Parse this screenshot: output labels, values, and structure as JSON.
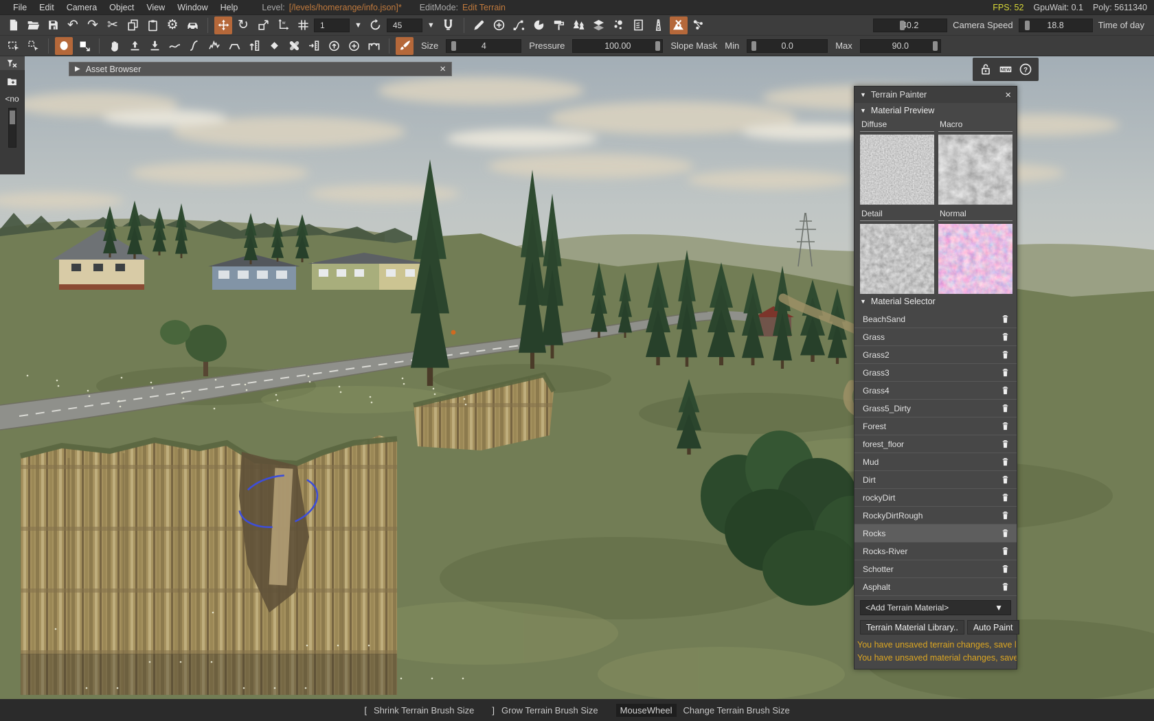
{
  "colors": {
    "accent": "#b5683a",
    "warn": "#dca622",
    "fps": "#d8d838",
    "level": "#c07a3d",
    "selection": "#5e5e5e"
  },
  "menu_bar": {
    "items": [
      "File",
      "Edit",
      "Camera",
      "Object",
      "View",
      "Window",
      "Help"
    ],
    "level_label": "Level:",
    "level_value": "[/levels/homerange/info.json]*",
    "editmode_label": "EditMode:",
    "editmode_value": "Edit Terrain",
    "fps_label": "FPS:",
    "fps_value": "52",
    "gpuwait_label": "GpuWait:",
    "gpuwait_value": "0.1",
    "poly_label": "Poly:",
    "poly_value": "5611340"
  },
  "toolbar_main": {
    "groups": {
      "file": [
        {
          "name": "new-file"
        },
        {
          "name": "open-folder"
        },
        {
          "name": "save-file"
        },
        {
          "name": "undo"
        },
        {
          "name": "redo"
        },
        {
          "name": "cut"
        },
        {
          "name": "copy"
        },
        {
          "name": "paste"
        },
        {
          "name": "settings"
        },
        {
          "name": "vehicle"
        }
      ],
      "transform": [
        {
          "name": "translate-tool",
          "active": true
        },
        {
          "name": "rotate-tool"
        },
        {
          "name": "scale-tool"
        },
        {
          "name": "world-axis"
        },
        {
          "name": "snap-grid"
        }
      ],
      "rotsnap": [
        {
          "name": "rotate-snap"
        }
      ],
      "magnet": [
        {
          "name": "terrain-magnet"
        }
      ],
      "tools": [
        {
          "name": "draw-pencil"
        },
        {
          "name": "add-object"
        },
        {
          "name": "spline-tool"
        },
        {
          "name": "sphere-tool"
        },
        {
          "name": "paint-roller"
        },
        {
          "name": "forest-tool"
        },
        {
          "name": "mesh-road-tool"
        },
        {
          "name": "particle-tool"
        },
        {
          "name": "river-tool"
        },
        {
          "name": "road-tool"
        },
        {
          "name": "terrain-painter-tool",
          "active": true
        },
        {
          "name": "mesh-nodes-tool"
        }
      ]
    },
    "snap_size_value": "1",
    "rotate_snap_value": "45",
    "camera_speed": {
      "value": "40.2",
      "label": "Camera Speed"
    },
    "time_of_day": {
      "value": "18.8",
      "label": "Time of day"
    }
  },
  "toolbar_terrain": {
    "groups": {
      "select": [
        {
          "name": "select-tool"
        },
        {
          "name": "select-move-tool"
        }
      ],
      "brush": [
        {
          "name": "brush-ellipse",
          "active": true
        },
        {
          "name": "brush-square"
        }
      ],
      "terrain": [
        {
          "name": "grab-terrain-tool"
        },
        {
          "name": "raise-height-tool"
        },
        {
          "name": "lower-height-tool"
        },
        {
          "name": "smooth-tool"
        },
        {
          "name": "slope-tool"
        },
        {
          "name": "noise-tool"
        },
        {
          "name": "flatten-tool"
        },
        {
          "name": "set-height-tool"
        },
        {
          "name": "erase-layer-tool"
        },
        {
          "name": "blend-tool"
        },
        {
          "name": "copy-height-tool"
        },
        {
          "name": "brush-add-tool"
        },
        {
          "name": "brush-add2-tool"
        },
        {
          "name": "ramp-tool"
        }
      ],
      "paint": [
        {
          "name": "paint-material-tool",
          "active": true
        }
      ]
    },
    "size": {
      "label": "Size",
      "value": "4"
    },
    "pressure": {
      "label": "Pressure",
      "value": "100.00"
    },
    "slope_mask_label": "Slope Mask",
    "min": {
      "label": "Min",
      "value": "0.0"
    },
    "max": {
      "label": "Max",
      "value": "90.0"
    }
  },
  "left_strip": {
    "layer_value": "<no",
    "icons": [
      "filter-clear-icon",
      "folder-plus-icon"
    ]
  },
  "asset_browser": {
    "title": "Asset Browser",
    "close_label": "×"
  },
  "viewport_corner_icons": [
    "lock-icon",
    "new-badge-icon",
    "help-icon"
  ],
  "terrain_painter": {
    "title": "Terrain Painter",
    "close_label": "×",
    "material_preview": {
      "title": "Material Preview",
      "slots": [
        "Diffuse",
        "Macro",
        "Detail",
        "Normal"
      ]
    },
    "material_selector": {
      "title": "Material Selector",
      "materials": [
        "BeachSand",
        "Grass",
        "Grass2",
        "Grass3",
        "Grass4",
        "Grass5_Dirty",
        "Forest",
        "forest_floor",
        "Mud",
        "Dirt",
        "rockyDirt",
        "RockyDirtRough",
        "Rocks",
        "Rocks-River",
        "Schotter",
        "Asphalt"
      ],
      "selected": "Rocks",
      "delete_icon": "trash-icon",
      "add_dropdown": "<Add Terrain Material>",
      "library_button": "Terrain Material Library..",
      "auto_paint_button": "Auto Paint"
    },
    "warnings": [
      "You have unsaved terrain changes, save le",
      "You have unsaved material changes, save"
    ]
  },
  "status_bar": {
    "shortcuts": [
      {
        "key": "[",
        "action": "Shrink Terrain Brush Size"
      },
      {
        "key": "]",
        "action": "Grow Terrain Brush Size"
      },
      {
        "key": "MouseWheel",
        "action": "Change Terrain Brush Size"
      }
    ]
  }
}
